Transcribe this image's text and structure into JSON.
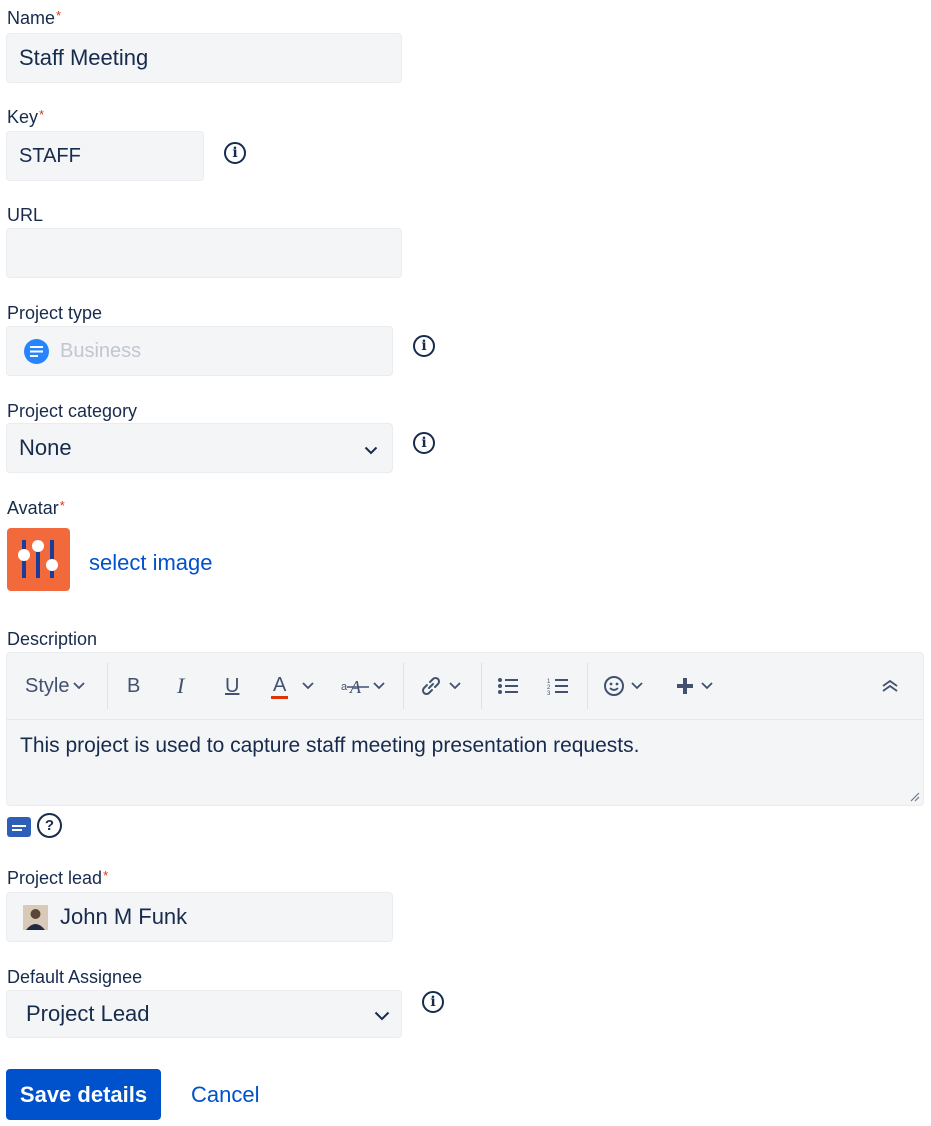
{
  "fields": {
    "name": {
      "label": "Name",
      "required": "*",
      "value": "Staff Meeting"
    },
    "key": {
      "label": "Key",
      "required": "*",
      "value": "STAFF"
    },
    "url": {
      "label": "URL",
      "value": ""
    },
    "project_type": {
      "label": "Project type",
      "value": "Business"
    },
    "project_category": {
      "label": "Project category",
      "value": "None"
    },
    "avatar": {
      "label": "Avatar",
      "required": "*",
      "select_label": "select image"
    },
    "description": {
      "label": "Description",
      "value": "This project is used to capture staff meeting presentation requests."
    },
    "project_lead": {
      "label": "Project lead",
      "required": "*",
      "value": "John M Funk"
    },
    "default_assignee": {
      "label": "Default Assignee",
      "value": "Project Lead"
    }
  },
  "toolbar": {
    "style_label": "Style",
    "bold_label": "B",
    "italic_label": "I",
    "underline_label": "U",
    "text_color_label": "A",
    "text_color": "#de350b"
  },
  "icons": {
    "info": "info-icon",
    "help": "help-icon",
    "chevron": "chevron-down-icon",
    "business": "business-icon",
    "link": "link-icon",
    "emoji": "emoji-icon",
    "insert": "plus-icon",
    "collapse": "collapse-icon"
  },
  "buttons": {
    "save": "Save details",
    "cancel": "Cancel"
  },
  "colors": {
    "primary": "#0052cc",
    "avatar_bg": "#f26a3c",
    "required": "#de350b",
    "field_bg": "#f4f5f7"
  }
}
